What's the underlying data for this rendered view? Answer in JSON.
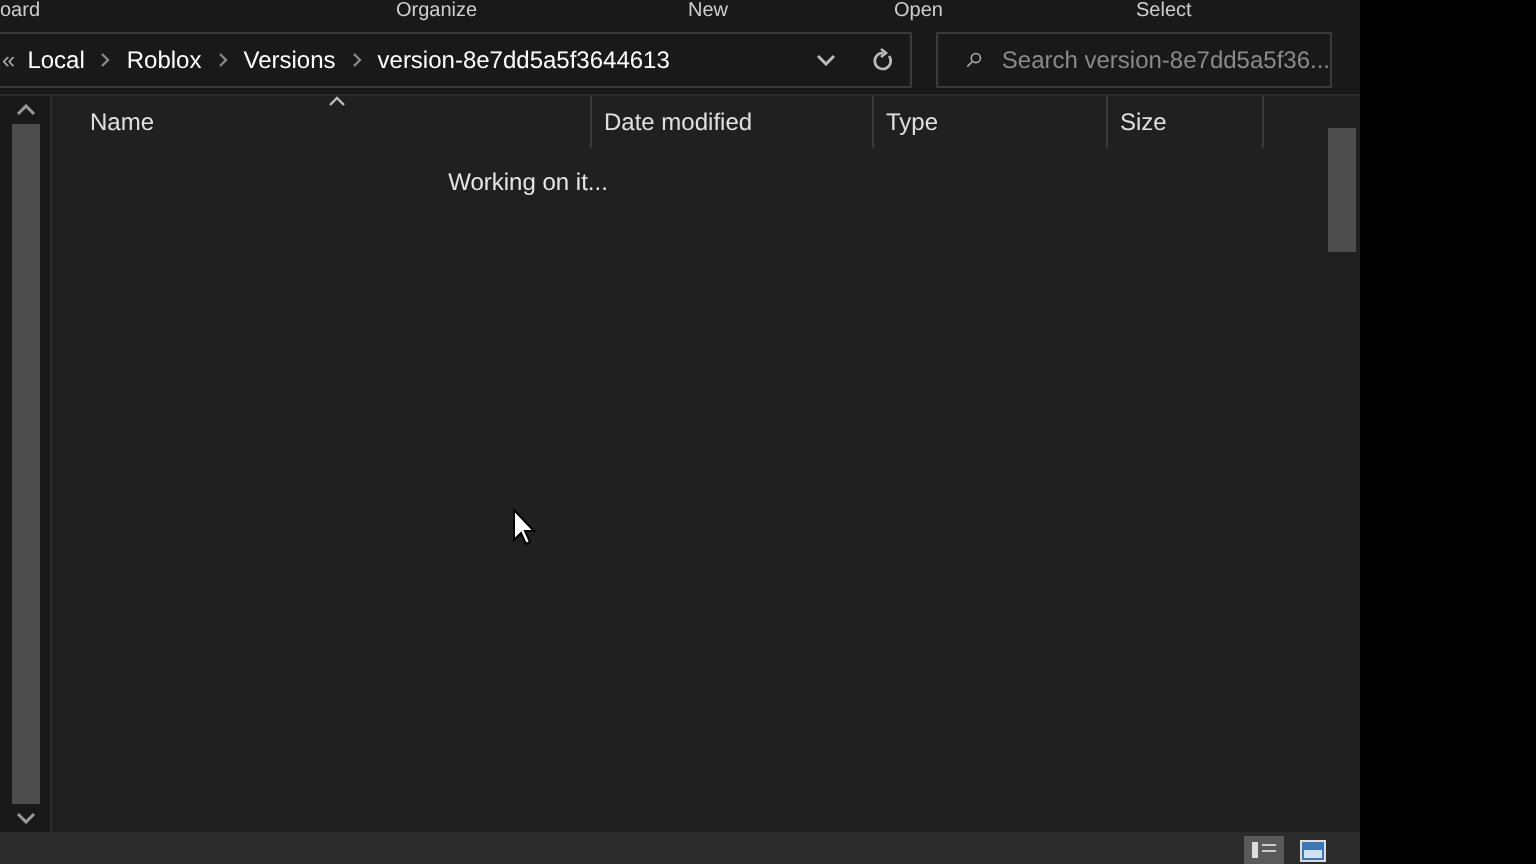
{
  "ribbon_groups": [
    "oard",
    "Organize",
    "New",
    "Open",
    "Select"
  ],
  "address_bar": {
    "overflow": "«",
    "path": [
      "Local",
      "Roblox",
      "Versions",
      "version-8e7dd5a5f3644613"
    ]
  },
  "search": {
    "placeholder": "Search version-8e7dd5a5f36..."
  },
  "columns": [
    {
      "label": "Name",
      "sorted": true
    },
    {
      "label": "Date modified",
      "sorted": false
    },
    {
      "label": "Type",
      "sorted": false
    },
    {
      "label": "Size",
      "sorted": false
    }
  ],
  "status_message": "Working on it...",
  "view_buttons": [
    {
      "kind": "details",
      "selected": true
    },
    {
      "kind": "tiles",
      "selected": false
    }
  ]
}
